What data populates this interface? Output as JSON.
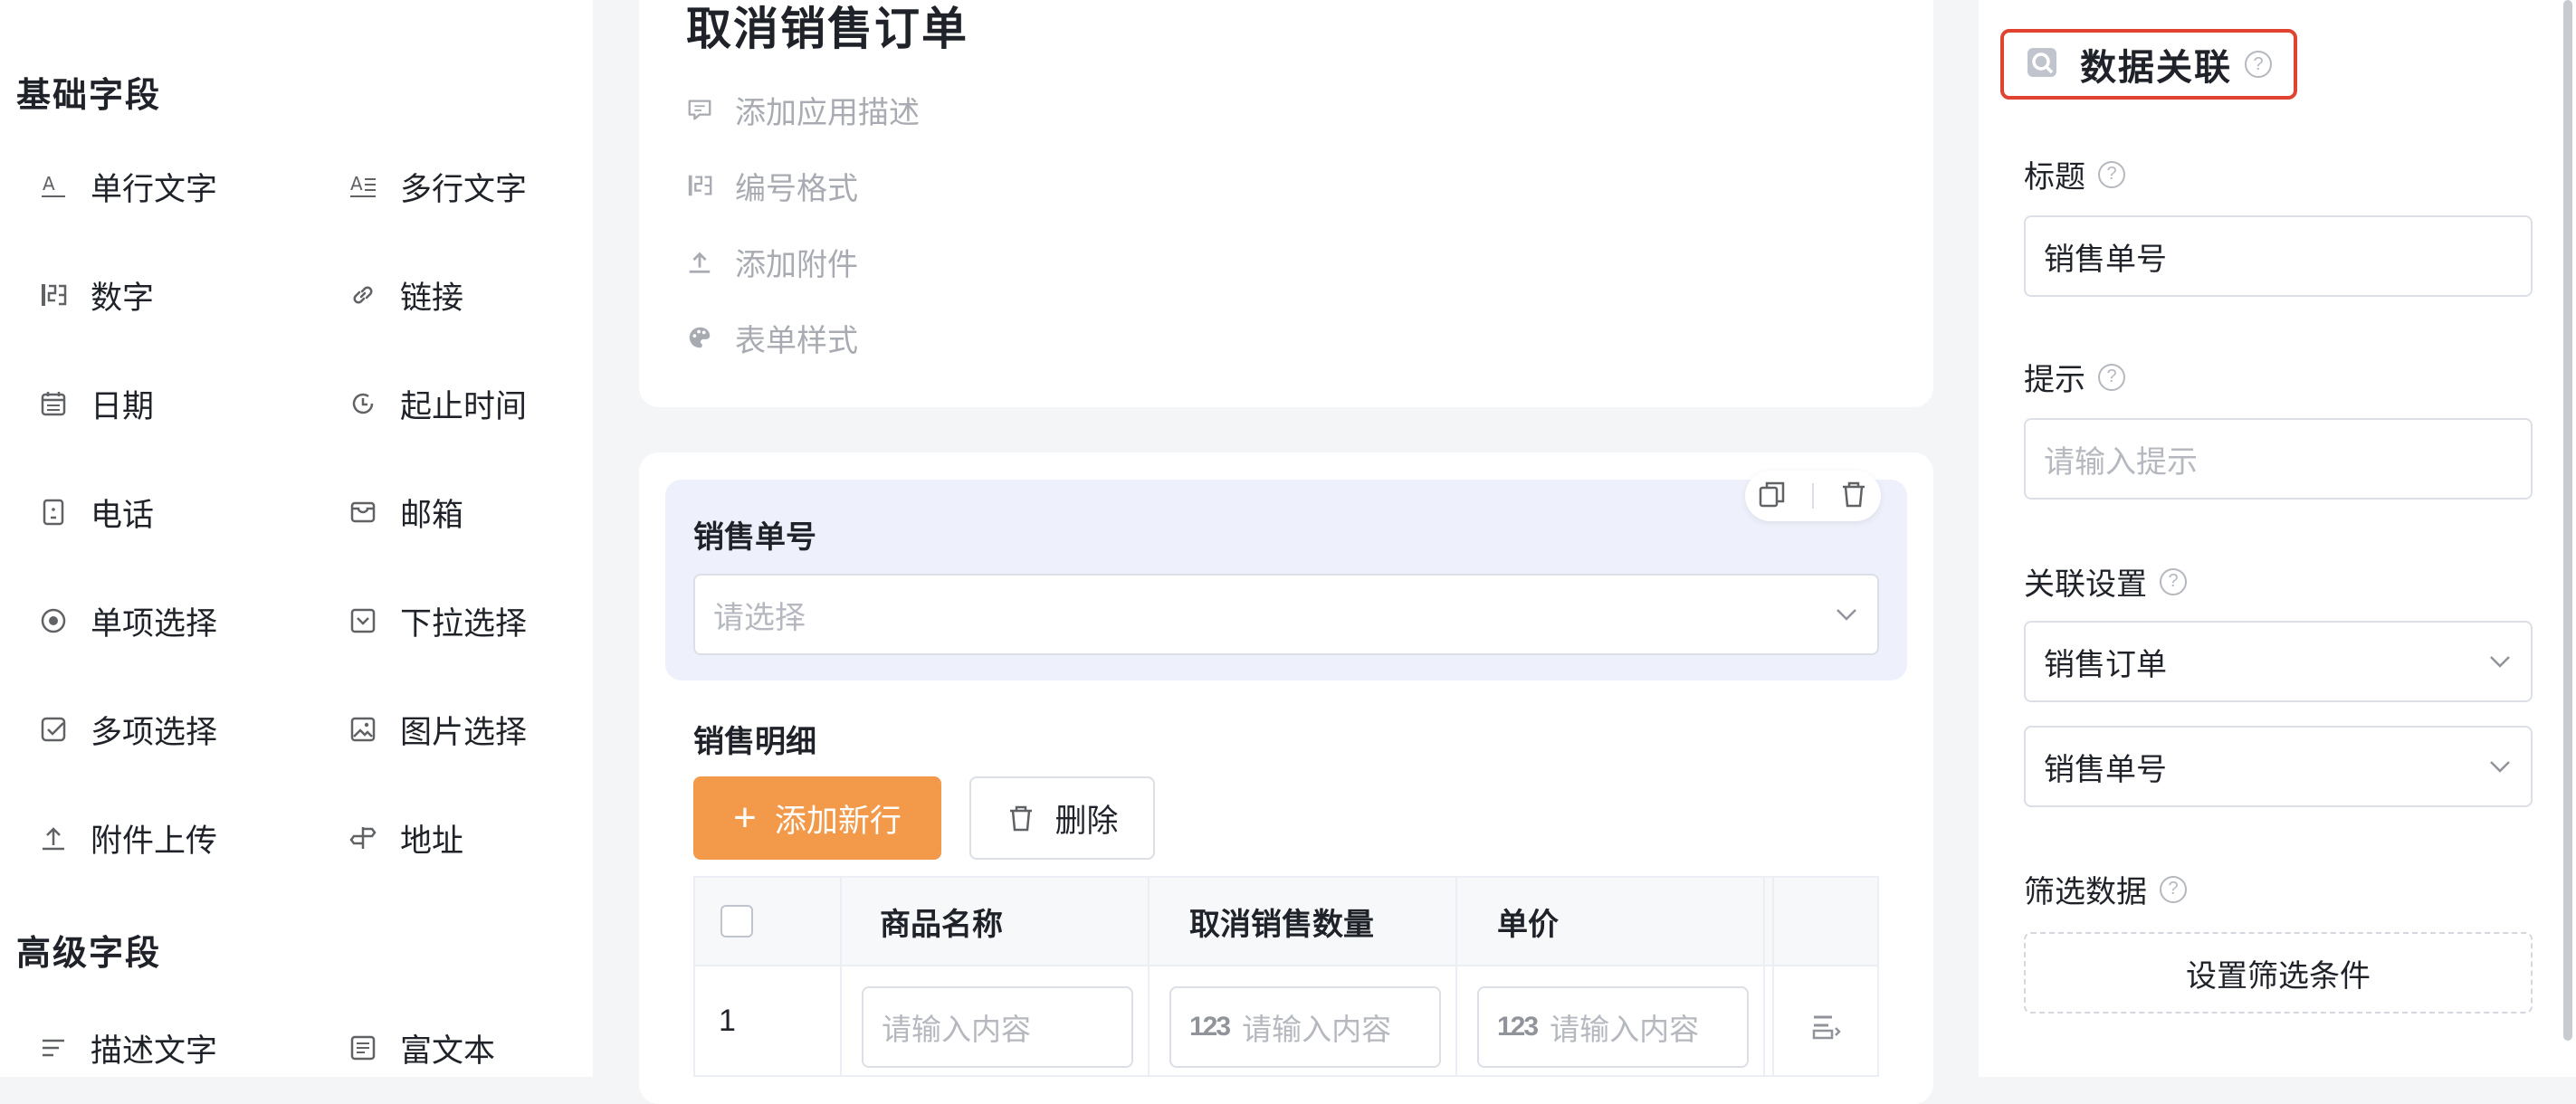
{
  "palette": {
    "basic_title": "基础字段",
    "basic_items": [
      {
        "label": "单行文字",
        "icon": "single-line-text-icon"
      },
      {
        "label": "多行文字",
        "icon": "multi-line-text-icon"
      },
      {
        "label": "数字",
        "icon": "number-icon"
      },
      {
        "label": "链接",
        "icon": "link-icon"
      },
      {
        "label": "日期",
        "icon": "calendar-icon"
      },
      {
        "label": "起止时间",
        "icon": "time-range-icon"
      },
      {
        "label": "电话",
        "icon": "phone-icon"
      },
      {
        "label": "邮箱",
        "icon": "mail-icon"
      },
      {
        "label": "单项选择",
        "icon": "radio-icon"
      },
      {
        "label": "下拉选择",
        "icon": "dropdown-icon"
      },
      {
        "label": "多项选择",
        "icon": "checkbox-icon"
      },
      {
        "label": "图片选择",
        "icon": "image-icon"
      },
      {
        "label": "附件上传",
        "icon": "upload-icon"
      },
      {
        "label": "地址",
        "icon": "location-icon"
      }
    ],
    "advanced_title": "高级字段",
    "advanced_items": [
      {
        "label": "描述文字",
        "icon": "description-icon"
      },
      {
        "label": "富文本",
        "icon": "rich-text-icon"
      }
    ]
  },
  "form": {
    "title": "取消销售订单",
    "meta": [
      {
        "label": "添加应用描述",
        "icon": "comment-icon"
      },
      {
        "label": "编号格式",
        "icon": "number-format-icon"
      },
      {
        "label": "添加附件",
        "icon": "upload-icon"
      },
      {
        "label": "表单样式",
        "icon": "palette-icon"
      }
    ],
    "selected_field": {
      "label": "销售单号",
      "placeholder": "请选择"
    },
    "detail": {
      "label": "销售明细",
      "add_row": "添加新行",
      "delete": "删除",
      "columns": [
        "商品名称",
        "取消销售数量",
        "单价"
      ],
      "rows": [
        {
          "index": "1",
          "name_placeholder": "请输入内容",
          "qty_prefix": "123",
          "qty_placeholder": "请输入内容",
          "price_prefix": "123",
          "price_placeholder": "请输入内容"
        }
      ]
    }
  },
  "panel": {
    "title": "数据关联",
    "help": "?",
    "title_label": "标题",
    "title_value": "销售单号",
    "hint_label": "提示",
    "hint_placeholder": "请输入提示",
    "link_label": "关联设置",
    "link_form": "销售订单",
    "link_field": "销售单号",
    "filter_label": "筛选数据",
    "filter_button": "设置筛选条件"
  },
  "colors": {
    "accent": "#f2994a",
    "highlight_border": "#e0432f",
    "selected_bg": "#eef1fb"
  }
}
